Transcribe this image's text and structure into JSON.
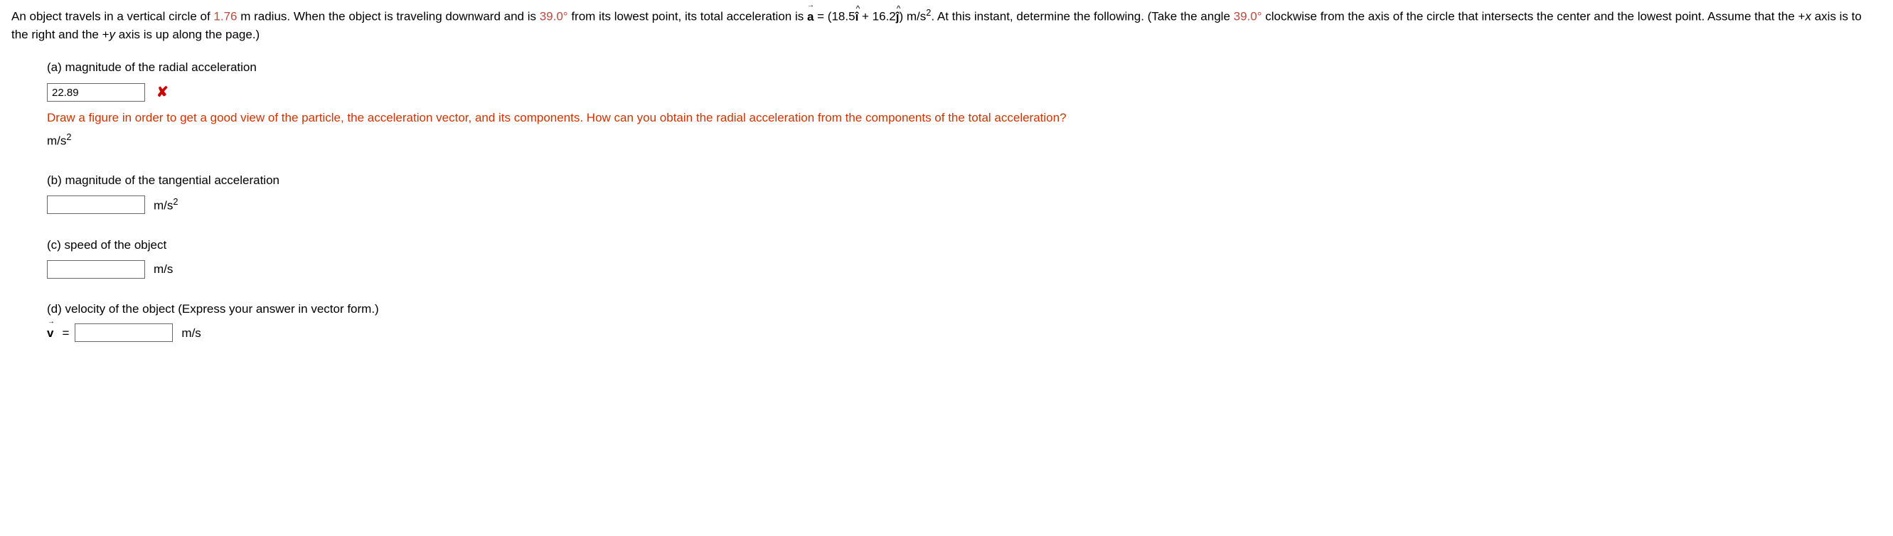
{
  "problem": {
    "text_before_radius": "An object travels in a vertical circle of ",
    "radius": "1.76",
    "text_after_radius": " m radius. When the object is traveling downward and is ",
    "angle1": "39.0°",
    "text_after_angle1": " from its lowest point, its total acceleration is ",
    "accel_expr_1": " = (18.5",
    "accel_expr_2": " + 16.2",
    "accel_expr_3": ") m/s",
    "text_after_accel": ". At this instant, determine the following. (Take the angle ",
    "angle2": "39.0°",
    "text_after_angle2": " clockwise from the axis of the circle that intersects the center and the lowest point. Assume that the +",
    "x_var": "x",
    "text_after_x": " axis is to the right and the +",
    "y_var": "y",
    "text_after_y": " axis is up along the page.)"
  },
  "parts": {
    "a": {
      "label": "(a) magnitude of the radial acceleration",
      "value": "22.89",
      "feedback": "Draw a figure in order to get a good view of the particle, the acceleration vector, and its components. How can you obtain the radial acceleration from the components of the total acceleration?",
      "unit_prefix": "m/s"
    },
    "b": {
      "label": "(b) magnitude of the tangential acceleration",
      "value": "",
      "unit_prefix": "m/s"
    },
    "c": {
      "label": "(c) speed of the object",
      "value": "",
      "unit": "m/s"
    },
    "d": {
      "label": "(d) velocity of the object (Express your answer in vector form.)",
      "equals": " = ",
      "value": "",
      "unit": "m/s"
    }
  }
}
